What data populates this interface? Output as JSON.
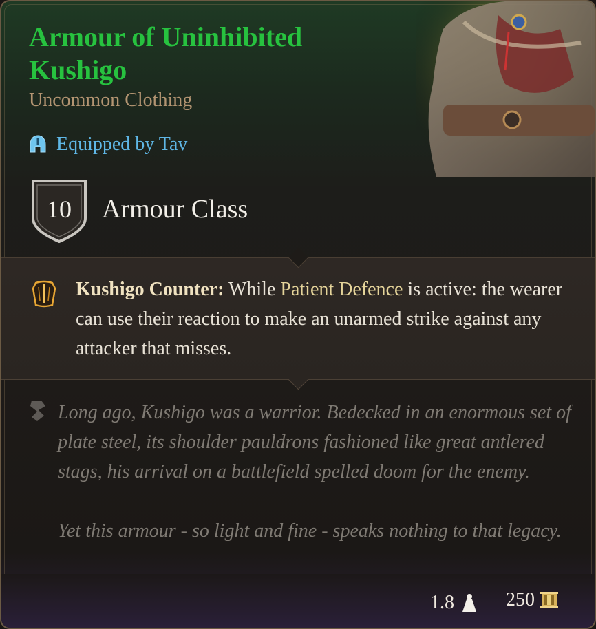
{
  "item": {
    "name": "Armour of Uninhibited Kushigo",
    "rarity_type": "Uncommon Clothing",
    "equipped_text": "Equipped by Tav",
    "armour_class_value": "10",
    "armour_class_label": "Armour Class"
  },
  "passive": {
    "name": "Kushigo Counter:",
    "text_before": " While ",
    "link": "Patient Defence",
    "text_after": " is active: the wearer can use their reaction to make an unarmed strike against any attacker that misses."
  },
  "lore": {
    "paragraph1": "Long ago, Kushigo was a warrior. Bedecked in an enormous set of plate steel, its shoulder pauldrons fashioned like great antlered stags, his arrival on a battlefield spelled doom for the enemy.",
    "paragraph2": "Yet this armour - so light and fine - speaks nothing to that legacy."
  },
  "footer": {
    "weight": "1.8",
    "value": "250"
  },
  "icons": {
    "equipped": "helmet-icon",
    "armour_class": "shield-icon",
    "passive": "armour-passive-icon",
    "lore": "scroll-icon",
    "weight": "weight-icon",
    "gold": "gold-coin-icon",
    "portrait": "item-portrait"
  },
  "colors": {
    "title": "#27c23f",
    "subtitle": "#b39572",
    "equipped": "#5fb7e6",
    "passive_link": "#e5d49a",
    "lore": "#7f7a73"
  }
}
